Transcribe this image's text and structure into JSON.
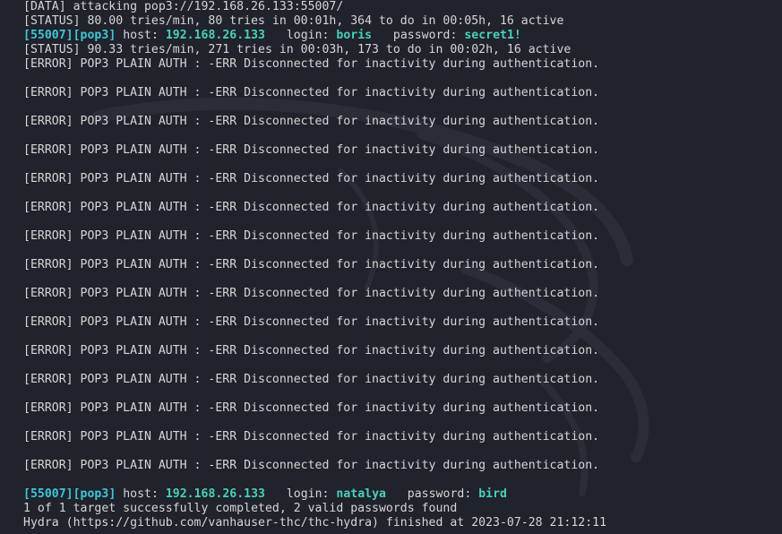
{
  "terminal": {
    "line_data": "[DATA] attacking pop3://192.168.26.133:55007/",
    "line_status1": "[STATUS] 80.00 tries/min, 80 tries in 00:01h, 364 to do in 00:05h, 16 active",
    "found1": {
      "open": "[",
      "port": "55007",
      "mid": "][",
      "service": "pop3",
      "close": "]",
      "host_label": " host: ",
      "host": "192.168.26.133",
      "login_label": "   login: ",
      "login": "boris",
      "password_label": "   password: ",
      "password": "secret1!"
    },
    "line_status2": "[STATUS] 90.33 tries/min, 271 tries in 00:03h, 173 to do in 00:02h, 16 active",
    "errors": [
      "[ERROR] POP3 PLAIN AUTH : -ERR Disconnected for inactivity during authentication.",
      "[ERROR] POP3 PLAIN AUTH : -ERR Disconnected for inactivity during authentication.",
      "[ERROR] POP3 PLAIN AUTH : -ERR Disconnected for inactivity during authentication.",
      "[ERROR] POP3 PLAIN AUTH : -ERR Disconnected for inactivity during authentication.",
      "[ERROR] POP3 PLAIN AUTH : -ERR Disconnected for inactivity during authentication.",
      "[ERROR] POP3 PLAIN AUTH : -ERR Disconnected for inactivity during authentication.",
      "[ERROR] POP3 PLAIN AUTH : -ERR Disconnected for inactivity during authentication.",
      "[ERROR] POP3 PLAIN AUTH : -ERR Disconnected for inactivity during authentication.",
      "[ERROR] POP3 PLAIN AUTH : -ERR Disconnected for inactivity during authentication.",
      "[ERROR] POP3 PLAIN AUTH : -ERR Disconnected for inactivity during authentication.",
      "[ERROR] POP3 PLAIN AUTH : -ERR Disconnected for inactivity during authentication.",
      "[ERROR] POP3 PLAIN AUTH : -ERR Disconnected for inactivity during authentication.",
      "[ERROR] POP3 PLAIN AUTH : -ERR Disconnected for inactivity during authentication.",
      "[ERROR] POP3 PLAIN AUTH : -ERR Disconnected for inactivity during authentication.",
      "[ERROR] POP3 PLAIN AUTH : -ERR Disconnected for inactivity during authentication."
    ],
    "found2": {
      "open": "[",
      "port": "55007",
      "mid": "][",
      "service": "pop3",
      "close": "]",
      "host_label": " host: ",
      "host": "192.168.26.133",
      "login_label": "   login: ",
      "login": "natalya",
      "password_label": "   password: ",
      "password": "bird"
    },
    "line_summary": "1 of 1 target successfully completed, 2 valid passwords found",
    "line_finished": "Hydra (https://github.com/vanhauser-thc/thc-hydra) finished at 2023-07-28 21:12:11"
  },
  "colors": {
    "background": "#20222c",
    "text": "#d6d6d6",
    "highlight_cyan": "#3fc6d6",
    "highlight_teal": "#48d1b8"
  },
  "background_icon": "kali-dragon-watermark-icon"
}
